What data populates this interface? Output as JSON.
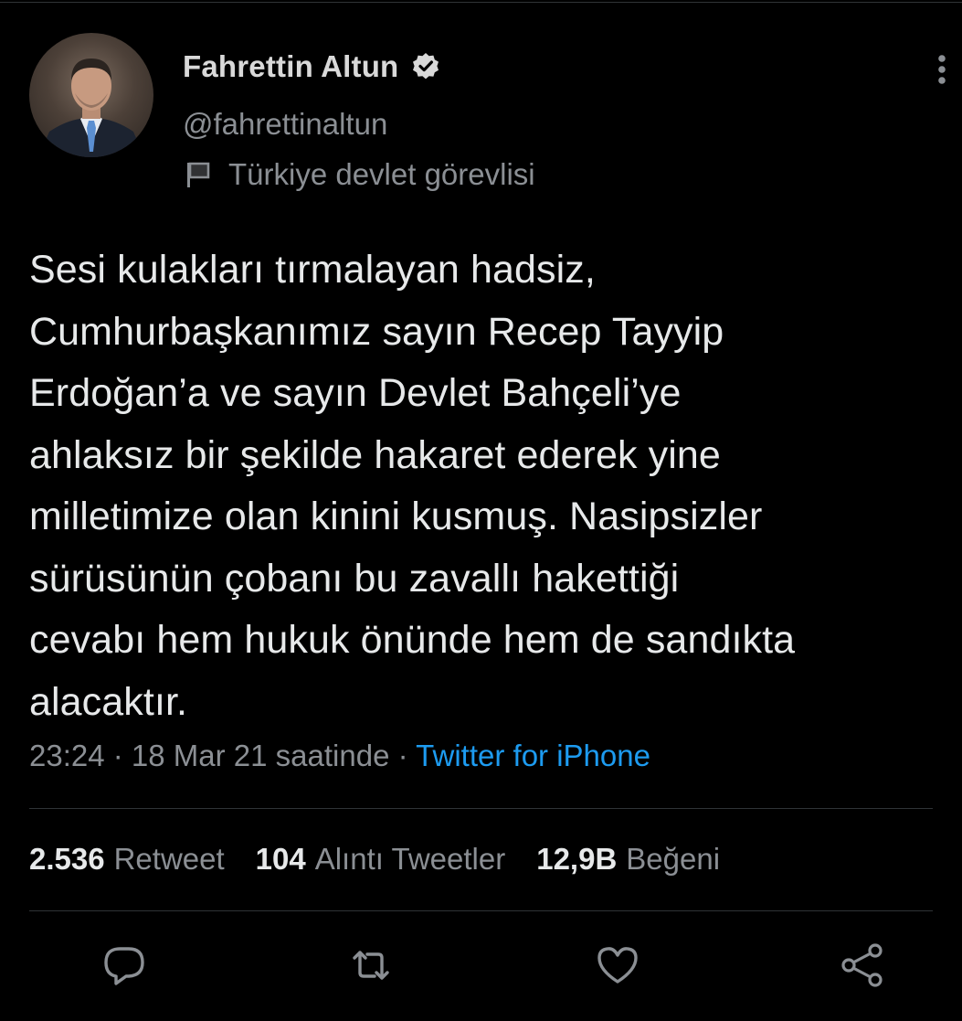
{
  "author": {
    "display_name": "Fahrettin Altun",
    "handle": "@fahrettinaltun",
    "label": "Türkiye devlet görevlisi",
    "verified": true
  },
  "icons": {
    "verified": "verified-badge-icon",
    "label": "flag-icon",
    "more": "more-vertical-icon",
    "reply": "reply-icon",
    "retweet": "retweet-icon",
    "like": "like-icon",
    "share": "share-icon"
  },
  "tweet": {
    "text": "Sesi kulakları tırmalayan hadsiz,\nCumhurbaşkanımız sayın Recep Tayyip\nErdoğan’a ve sayın Devlet Bahçeli’ye\nahlaksız bir şekilde hakaret ederek yine\nmilletimize olan kinini kusmuş. Nasipsizler\nsürüsünün çobanı bu zavallı hakettiği\ncevabı hem hukuk önünde hem de sandıkta\nalacaktır.",
    "time": "23:24",
    "date": "18 Mar 21 saatinde",
    "separator": " · ",
    "source": "Twitter for iPhone"
  },
  "stats": {
    "retweets": {
      "count": "2.536",
      "label": "Retweet"
    },
    "quotes": {
      "count": "104",
      "label": "Alıntı Tweetler"
    },
    "likes": {
      "count": "12,9B",
      "label": "Beğeni"
    }
  },
  "colors": {
    "background": "#000000",
    "text_primary": "#e7e9ea",
    "text_secondary": "#8b8f94",
    "link": "#1d9bf0",
    "divider": "#2f3336"
  }
}
